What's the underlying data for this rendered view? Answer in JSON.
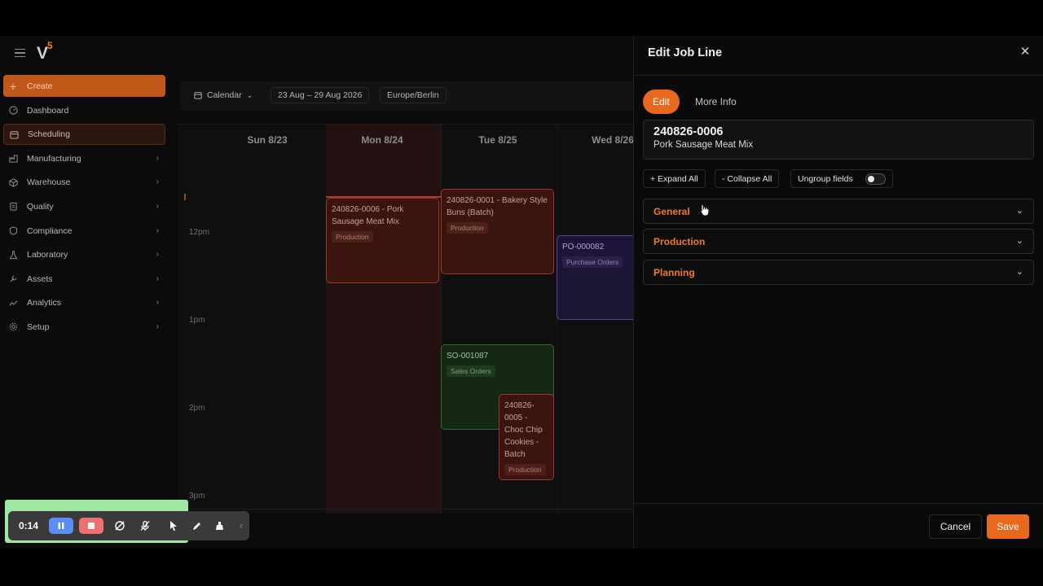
{
  "app": {
    "logo_text": "V5",
    "logo_accent": "#f07a2a"
  },
  "sidebar": {
    "items": [
      {
        "label": "Create",
        "icon": "plus-icon"
      },
      {
        "label": "Dashboard",
        "icon": "gauge-icon"
      },
      {
        "label": "Scheduling",
        "icon": "calendar-icon"
      },
      {
        "label": "Manufacturing",
        "icon": "factory-icon"
      },
      {
        "label": "Warehouse",
        "icon": "box-icon"
      },
      {
        "label": "Quality",
        "icon": "clipboard-icon"
      },
      {
        "label": "Compliance",
        "icon": "shield-icon"
      },
      {
        "label": "Laboratory",
        "icon": "flask-icon"
      },
      {
        "label": "Assets",
        "icon": "wrench-icon"
      },
      {
        "label": "Analytics",
        "icon": "trend-icon"
      },
      {
        "label": "Setup",
        "icon": "gear-icon"
      }
    ]
  },
  "toolbar": {
    "view_label": "Calendar",
    "date_range": "23 Aug – 29 Aug 2026",
    "timezone": "Europe/Berlin"
  },
  "calendar": {
    "days": [
      "Sun 8/23",
      "Mon 8/24",
      "Tue 8/25",
      "Wed 8/26"
    ],
    "times": [
      "12pm",
      "1pm",
      "2pm",
      "3pm"
    ],
    "events": [
      {
        "title": "240826-0006 - Pork Sausage Meat Mix",
        "tag": "Production"
      },
      {
        "title": "240826-0001 - Bakery Style Buns (Batch)",
        "tag": "Production"
      },
      {
        "title": "PO-000082",
        "tag": "Purchase Orders"
      },
      {
        "title": "SO-001087",
        "tag": "Sales Orders"
      },
      {
        "title": "240826-0005 - Choc Chip Cookies - Batch",
        "tag": "Production"
      }
    ]
  },
  "panel": {
    "title": "Edit Job Line",
    "tabs": [
      "Edit",
      "More Info"
    ],
    "job_number": "240826-0006",
    "job_name": "Pork Sausage Meat Mix",
    "expand_label": "+ Expand All",
    "collapse_label": "- Collapse All",
    "ungroup_label": "Ungroup fields",
    "sections": [
      "General",
      "Production",
      "Planning"
    ],
    "cancel_label": "Cancel",
    "save_label": "Save"
  },
  "recorder": {
    "time": "0:14"
  },
  "colors": {
    "accent": "#e8681e",
    "production": "#a0382a",
    "purchase": "#5a3e9e",
    "sales": "#2f6b2c"
  }
}
